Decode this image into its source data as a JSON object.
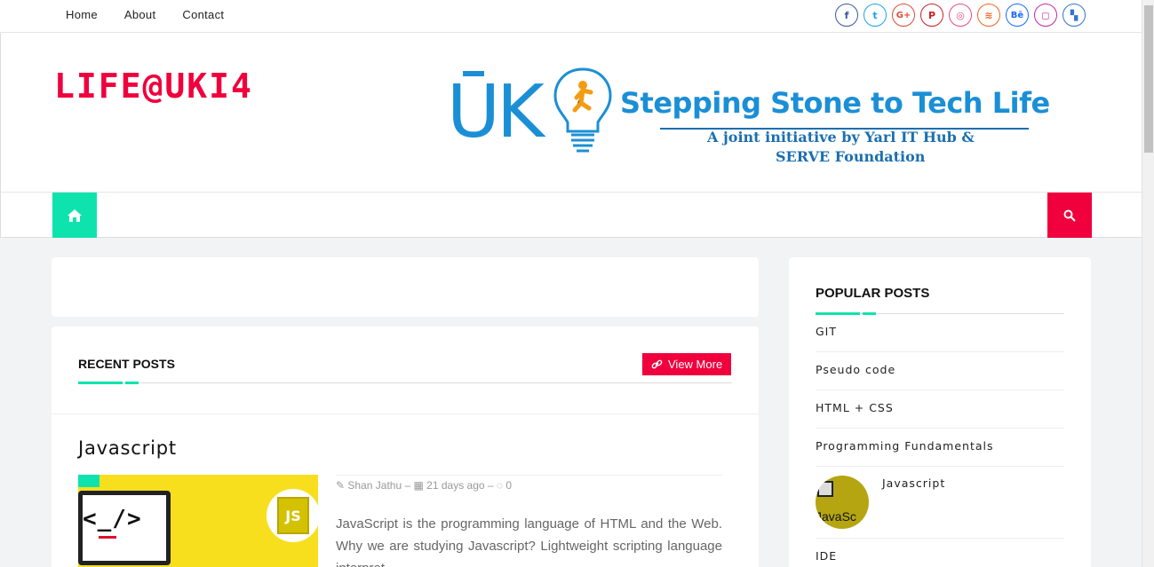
{
  "topnav": {
    "items": [
      "Home",
      "About",
      "Contact"
    ]
  },
  "social": {
    "icons": [
      {
        "name": "facebook-icon",
        "glyph": "f",
        "color": "#3b5998"
      },
      {
        "name": "twitter-icon",
        "glyph": "t",
        "color": "#1da1f2"
      },
      {
        "name": "google-plus-icon",
        "glyph": "G+",
        "color": "#dd4b39"
      },
      {
        "name": "pinterest-icon",
        "glyph": "P",
        "color": "#cb2027"
      },
      {
        "name": "dribbble-icon",
        "glyph": "◎",
        "color": "#ea4c89"
      },
      {
        "name": "rss-icon",
        "glyph": "≋",
        "color": "#f26522"
      },
      {
        "name": "behance-icon",
        "glyph": "Bē",
        "color": "#1769ff"
      },
      {
        "name": "instagram-icon",
        "glyph": "◻",
        "color": "#c32aa3"
      },
      {
        "name": "delicious-icon",
        "glyph": "▚",
        "color": "#3274d1"
      }
    ]
  },
  "header": {
    "logo": "LIFE@UKI4",
    "banner_mark": "ŪK",
    "banner_title": "Stepping Stone to Tech Life",
    "banner_sub1": "A joint initiative by Yarl IT Hub &",
    "banner_sub2": "SERVE Foundation"
  },
  "colors": {
    "accent": "#0fe3ad",
    "brand": "#f0003c",
    "banner_blue": "#1b8fd6"
  },
  "recent": {
    "heading": "RECENT POSTS",
    "view_more": "View More",
    "post": {
      "title": "Javascript",
      "author": "Shan Jathu",
      "date": "21 days ago",
      "comments": "0",
      "thumb_code": "<_/>",
      "thumb_badge": "JS",
      "excerpt": "JavaScript is the programming language of HTML and the Web. Why we are studying  Javascript? Lightweight scripting language interpret..."
    }
  },
  "sidebar": {
    "heading": "POPULAR POSTS",
    "items": [
      "GIT",
      "Pseudo code",
      "HTML + CSS",
      "Programming Fundamentals"
    ],
    "thumb_item": "Javascript",
    "thumb_text": "JavaSc",
    "last_item": "IDE"
  }
}
